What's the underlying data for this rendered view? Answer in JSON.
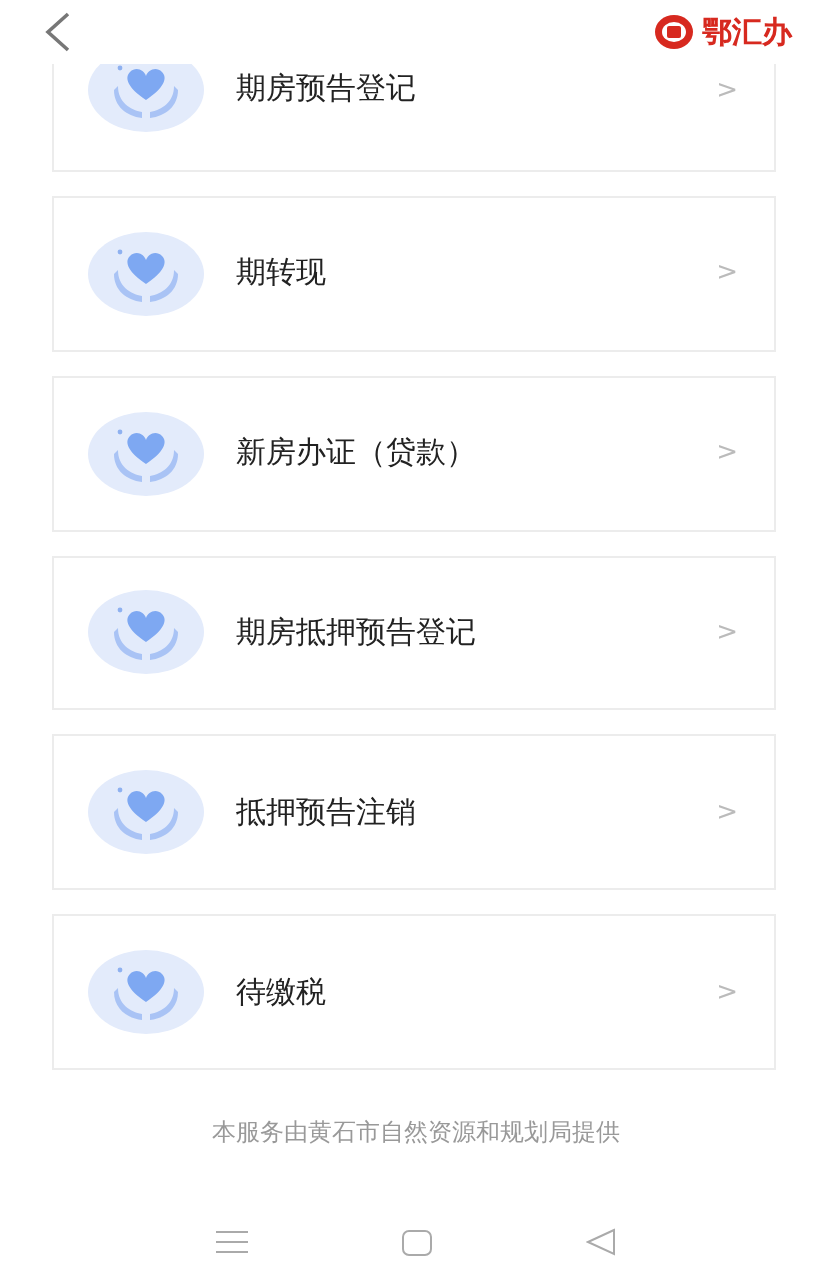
{
  "header": {
    "logo_text": "鄂汇办"
  },
  "services": [
    {
      "label": "期房预告登记",
      "arrow": ">"
    },
    {
      "label": "期转现",
      "arrow": ">"
    },
    {
      "label": "新房办证（贷款）",
      "arrow": ">"
    },
    {
      "label": "期房抵押预告登记",
      "arrow": ">"
    },
    {
      "label": "抵押预告注销",
      "arrow": ">"
    },
    {
      "label": "待缴税",
      "arrow": ">"
    }
  ],
  "footer": "本服务由黄石市自然资源和规划局提供"
}
